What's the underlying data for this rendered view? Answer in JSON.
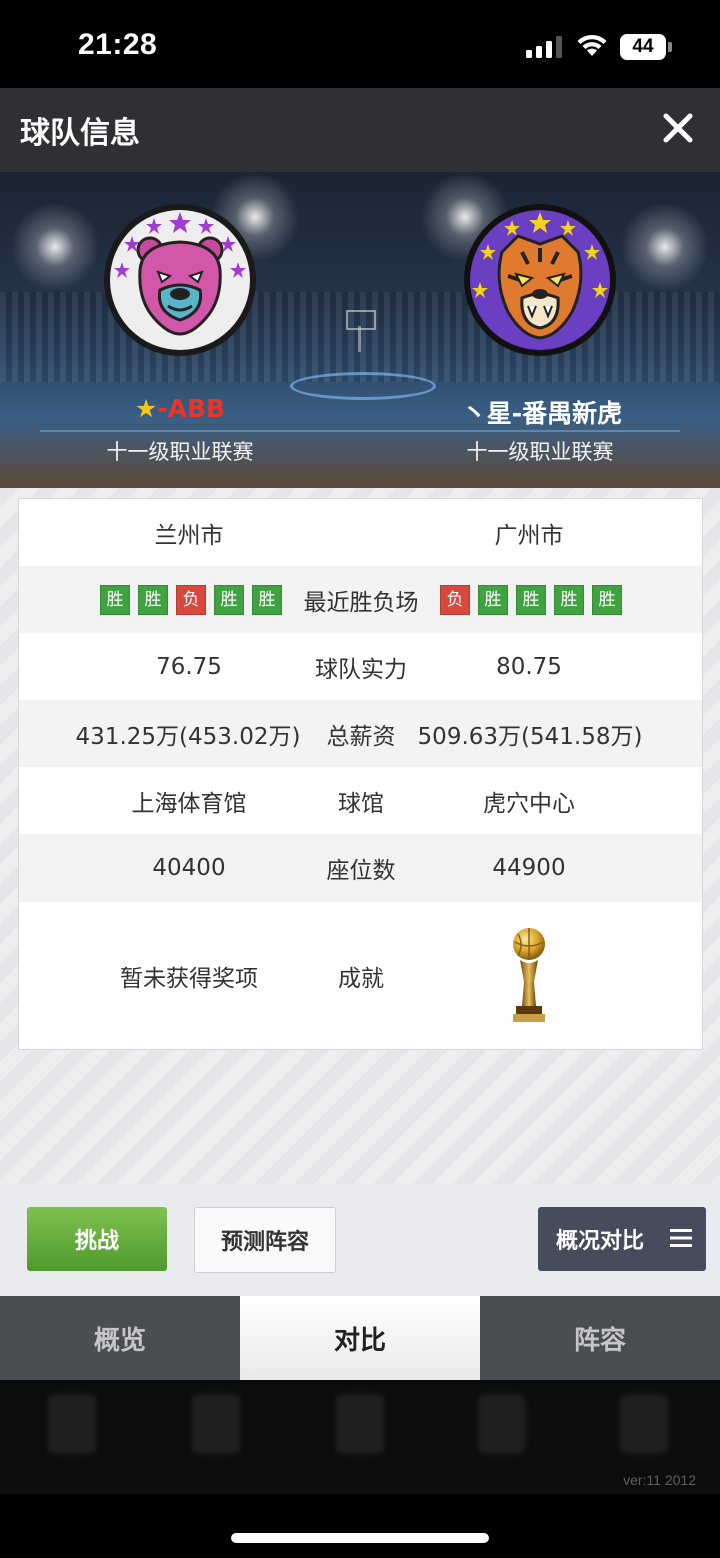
{
  "status_bar": {
    "time": "21:28",
    "battery": "44"
  },
  "header": {
    "title": "球队信息"
  },
  "teams": {
    "left": {
      "star": "★",
      "name": "-ABB",
      "league": "十一级职业联赛",
      "city": "兰州市",
      "recent": [
        "胜",
        "胜",
        "负",
        "胜",
        "胜"
      ],
      "strength": "76.75",
      "salary": "431.25万(453.02万)",
      "arena": "上海体育馆",
      "seats": "40400",
      "achievement": "暂未获得奖项"
    },
    "right": {
      "name": "丶星-番禺新虎",
      "league": "十一级职业联赛",
      "city": "广州市",
      "recent": [
        "负",
        "胜",
        "胜",
        "胜",
        "胜"
      ],
      "strength": "80.75",
      "salary": "509.63万(541.58万)",
      "arena": "虎穴中心",
      "seats": "44900",
      "achievement_icon": "trophy-icon"
    }
  },
  "labels": {
    "recent": "最近胜负场",
    "strength": "球队实力",
    "salary": "总薪资",
    "arena": "球馆",
    "seats": "座位数",
    "achievement": "成就"
  },
  "actions": {
    "challenge": "挑战",
    "predict": "预测阵容",
    "compare": "概况对比"
  },
  "tabs": [
    "概览",
    "对比",
    "阵容"
  ],
  "version": "ver:11  2012",
  "colors": {
    "win": "#3fa33f",
    "loss": "#d7483f",
    "accent_red": "#e8352c"
  }
}
